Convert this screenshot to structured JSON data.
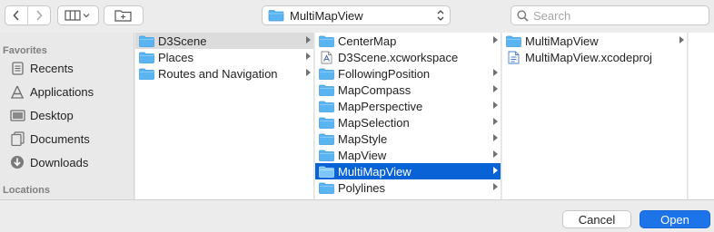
{
  "toolbar": {
    "location_label": "MultiMapView",
    "search_placeholder": "Search"
  },
  "sidebar": {
    "favorites_heading": "Favorites",
    "items": [
      {
        "label": "Recents",
        "icon": "recents-icon"
      },
      {
        "label": "Applications",
        "icon": "applications-icon"
      },
      {
        "label": "Desktop",
        "icon": "desktop-icon"
      },
      {
        "label": "Documents",
        "icon": "documents-icon"
      },
      {
        "label": "Downloads",
        "icon": "downloads-icon"
      }
    ],
    "locations_heading": "Locations"
  },
  "columns": [
    {
      "items": [
        {
          "label": "D3Scene",
          "type": "folder",
          "selected": "gray",
          "arrow": true
        },
        {
          "label": "Places",
          "type": "folder",
          "arrow": true
        },
        {
          "label": "Routes and Navigation",
          "type": "folder",
          "arrow": true
        }
      ]
    },
    {
      "items": [
        {
          "label": "CenterMap",
          "type": "folder",
          "arrow": true
        },
        {
          "label": "D3Scene.xcworkspace",
          "type": "file",
          "arrow": false
        },
        {
          "label": "FollowingPosition",
          "type": "folder",
          "arrow": true
        },
        {
          "label": "MapCompass",
          "type": "folder",
          "arrow": true
        },
        {
          "label": "MapPerspective",
          "type": "folder",
          "arrow": true
        },
        {
          "label": "MapSelection",
          "type": "folder",
          "arrow": true
        },
        {
          "label": "MapStyle",
          "type": "folder",
          "arrow": true
        },
        {
          "label": "MapView",
          "type": "folder",
          "arrow": true
        },
        {
          "label": "MultiMapView",
          "type": "folder",
          "selected": "blue",
          "arrow": true
        },
        {
          "label": "Polylines",
          "type": "folder",
          "arrow": true
        }
      ]
    },
    {
      "items": [
        {
          "label": "MultiMapView",
          "type": "folder",
          "arrow": true
        },
        {
          "label": "MultiMapView.xcodeproj",
          "type": "xcodeproj",
          "arrow": false
        }
      ]
    }
  ],
  "buttons": {
    "cancel": "Cancel",
    "open": "Open"
  },
  "colors": {
    "selection_blue": "#0a63d6",
    "open_button": "#1d73e8",
    "folder_blue": "#5ab4f2"
  }
}
